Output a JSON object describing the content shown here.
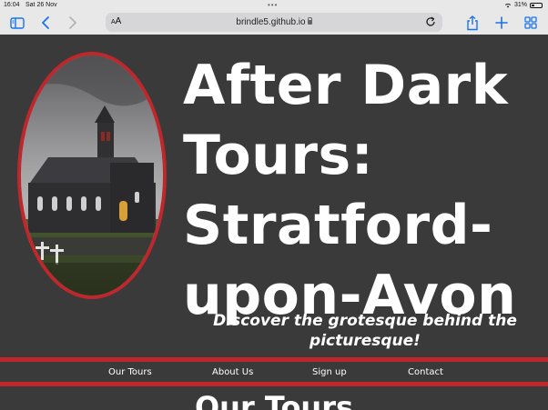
{
  "status_bar": {
    "time": "16:04",
    "date": "Sat 26 Nov",
    "battery": "31%"
  },
  "browser": {
    "url": "brindle5.github.io",
    "text_size_label_small": "A",
    "text_size_label_large": "A"
  },
  "page": {
    "title": "After Dark Tours: Stratford-upon-Avon",
    "tagline": "Discover the grotesque behind the picturesque!",
    "nav": {
      "our_tours": "Our Tours",
      "about_us": "About Us",
      "sign_up": "Sign up",
      "contact": "Contact"
    },
    "section_heading": "Our Tours"
  },
  "colors": {
    "page_background": "#3a3a3a",
    "accent_red": "#c0272d",
    "text": "#ffffff",
    "browser_chrome": "#e8e8e8",
    "browser_tint": "#1a73e8"
  },
  "icons": [
    "sidebar-icon",
    "back-chevron-icon",
    "forward-chevron-icon",
    "lock-icon",
    "reload-icon",
    "share-icon",
    "plus-icon",
    "tabs-grid-icon",
    "wifi-icon",
    "battery-icon"
  ]
}
